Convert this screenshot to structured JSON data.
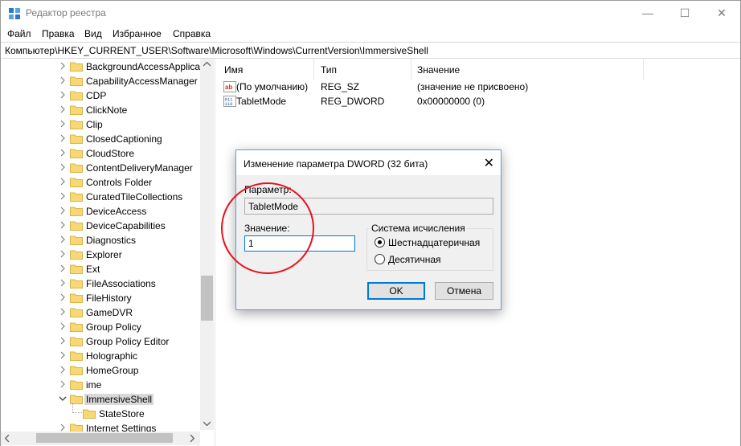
{
  "window": {
    "title": "Редактор реестра",
    "controls": {
      "minimize": "—",
      "maximize": "☐",
      "close": "✕"
    }
  },
  "menu": [
    "Файл",
    "Правка",
    "Вид",
    "Избранное",
    "Справка"
  ],
  "address": "Компьютер\\HKEY_CURRENT_USER\\Software\\Microsoft\\Windows\\CurrentVersion\\ImmersiveShell",
  "tree": {
    "items": [
      {
        "label": "BackgroundAccessApplica",
        "expanded": false
      },
      {
        "label": "CapabilityAccessManager",
        "expanded": false
      },
      {
        "label": "CDP",
        "expanded": false
      },
      {
        "label": "ClickNote",
        "expanded": false
      },
      {
        "label": "Clip",
        "expanded": false
      },
      {
        "label": "ClosedCaptioning",
        "expanded": false
      },
      {
        "label": "CloudStore",
        "expanded": false
      },
      {
        "label": "ContentDeliveryManager",
        "expanded": false
      },
      {
        "label": "Controls Folder",
        "expanded": false
      },
      {
        "label": "CuratedTileCollections",
        "expanded": false
      },
      {
        "label": "DeviceAccess",
        "expanded": false
      },
      {
        "label": "DeviceCapabilities",
        "expanded": false
      },
      {
        "label": "Diagnostics",
        "expanded": false
      },
      {
        "label": "Explorer",
        "expanded": false
      },
      {
        "label": "Ext",
        "expanded": false
      },
      {
        "label": "FileAssociations",
        "expanded": false
      },
      {
        "label": "FileHistory",
        "expanded": false
      },
      {
        "label": "GameDVR",
        "expanded": false
      },
      {
        "label": "Group Policy",
        "expanded": false
      },
      {
        "label": "Group Policy Editor",
        "expanded": false
      },
      {
        "label": "Holographic",
        "expanded": false
      },
      {
        "label": "HomeGroup",
        "expanded": false
      },
      {
        "label": "ime",
        "expanded": false
      },
      {
        "label": "ImmersiveShell",
        "expanded": true,
        "selected": true
      },
      {
        "label": "StateStore",
        "child": true
      },
      {
        "label": "Internet Settings",
        "expanded": false
      }
    ]
  },
  "list": {
    "columns": [
      "Имя",
      "Тип",
      "Значение"
    ],
    "rows": [
      {
        "icon": "string-value-icon",
        "name": "(По умолчанию)",
        "type": "REG_SZ",
        "data": "(значение не присвоено)"
      },
      {
        "icon": "dword-value-icon",
        "name": "TabletMode",
        "type": "REG_DWORD",
        "data": "0x00000000 (0)"
      }
    ]
  },
  "dialog": {
    "title": "Изменение параметра DWORD (32 бита)",
    "param_label": "Параметр:",
    "param_value": "TabletMode",
    "value_label": "Значение:",
    "value": "1",
    "base_legend": "Система исчисления",
    "base_hex": "Шестнадцатеричная",
    "base_dec": "Десятичная",
    "base_selected": "hex",
    "ok": "OK",
    "cancel": "Отмена"
  },
  "colors": {
    "annotation_circle": "#e8101c",
    "focus": "#0078d7",
    "folder": "#f7d774"
  }
}
